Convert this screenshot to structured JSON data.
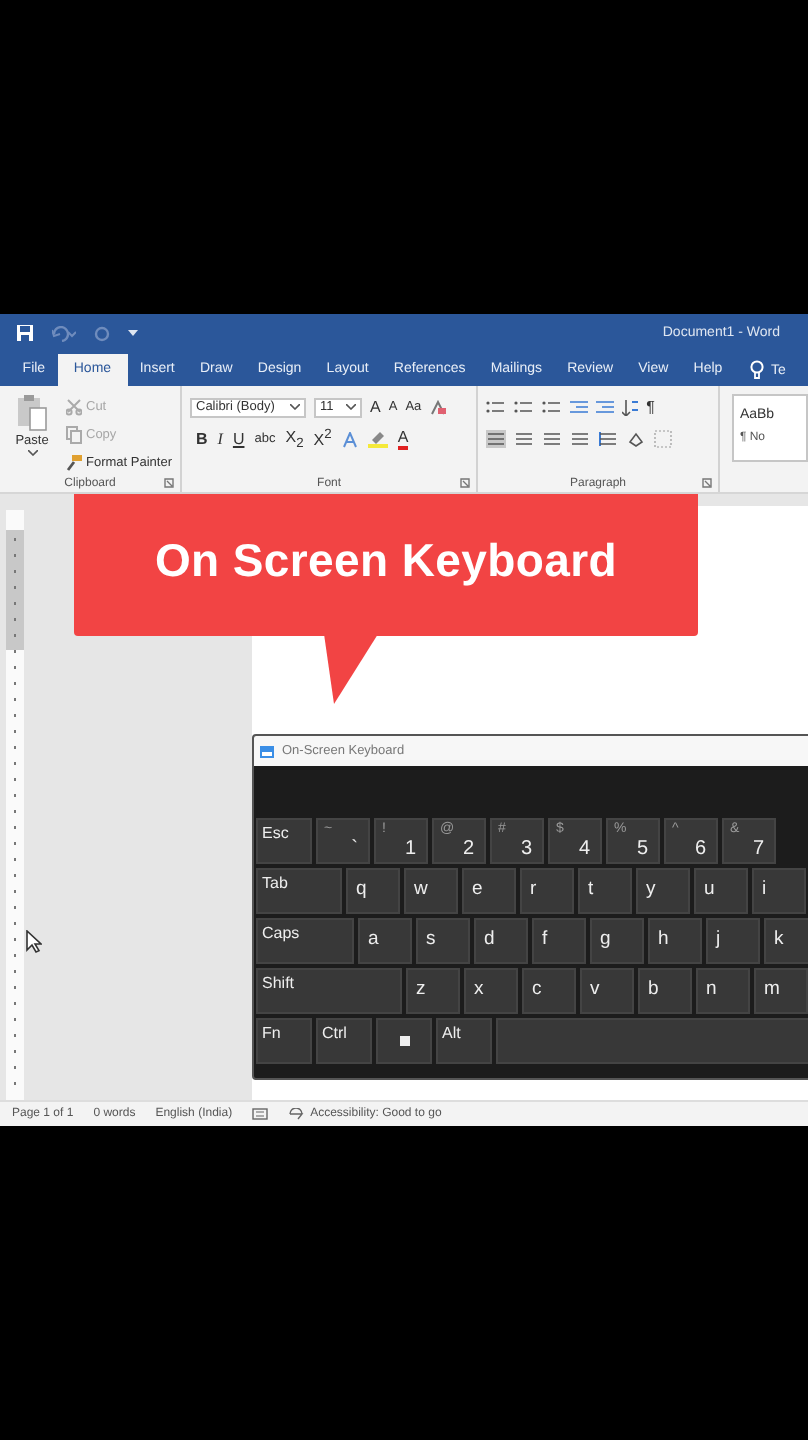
{
  "window": {
    "title": "Document1 - Word"
  },
  "tabs": [
    {
      "label": "File",
      "selected": false
    },
    {
      "label": "Home",
      "selected": true
    },
    {
      "label": "Insert",
      "selected": false
    },
    {
      "label": "Draw",
      "selected": false
    },
    {
      "label": "Design",
      "selected": false
    },
    {
      "label": "Layout",
      "selected": false
    },
    {
      "label": "References",
      "selected": false
    },
    {
      "label": "Mailings",
      "selected": false
    },
    {
      "label": "Review",
      "selected": false
    },
    {
      "label": "View",
      "selected": false
    },
    {
      "label": "Help",
      "selected": false
    }
  ],
  "tell_me": {
    "label": "Te"
  },
  "clipboard": {
    "label": "Clipboard",
    "paste": "Paste",
    "items": [
      {
        "label": "Cut",
        "disabled": true
      },
      {
        "label": "Copy",
        "disabled": true
      },
      {
        "label": "Format Painter",
        "disabled": false
      }
    ]
  },
  "font": {
    "label": "Font",
    "family": "Calibri (Body)",
    "size": "11",
    "grow": "A",
    "shrink": "A",
    "change_case": "Aa",
    "bold": "B",
    "italic": "I",
    "underline": "U",
    "strikethrough": "abc",
    "subscript": "X$_{2}$",
    "superscript": "X$^{2}$",
    "font_color": "A"
  },
  "paragraph": {
    "label": "Paragraph",
    "show_marks": "¶"
  },
  "styles": {
    "preview": "AaBb",
    "name": "¶ No"
  },
  "callout": {
    "text": "On Screen Keyboard"
  },
  "keyboard": {
    "title": "On-Screen Keyboard",
    "rows": [
      [
        {
          "kind": "text",
          "label": "Esc"
        },
        {
          "kind": "symbol",
          "shift": "~",
          "label": "`"
        },
        {
          "kind": "symbol",
          "shift": "!",
          "label": "1"
        },
        {
          "kind": "symbol",
          "shift": "@",
          "label": "2"
        },
        {
          "kind": "symbol",
          "shift": "#",
          "label": "3"
        },
        {
          "kind": "symbol",
          "shift": "$",
          "label": "4"
        },
        {
          "kind": "symbol",
          "shift": "%",
          "label": "5"
        },
        {
          "kind": "symbol",
          "shift": "^",
          "label": "6"
        },
        {
          "kind": "symbol",
          "shift": "&",
          "label": "7"
        }
      ],
      [
        {
          "kind": "text",
          "label": "Tab"
        },
        {
          "kind": "letter",
          "label": "q"
        },
        {
          "kind": "letter",
          "label": "w"
        },
        {
          "kind": "letter",
          "label": "e"
        },
        {
          "kind": "letter",
          "label": "r"
        },
        {
          "kind": "letter",
          "label": "t"
        },
        {
          "kind": "letter",
          "label": "y"
        },
        {
          "kind": "letter",
          "label": "u"
        },
        {
          "kind": "letter",
          "label": "i"
        }
      ],
      [
        {
          "kind": "text",
          "label": "Caps"
        },
        {
          "kind": "letter",
          "label": "a"
        },
        {
          "kind": "letter",
          "label": "s"
        },
        {
          "kind": "letter",
          "label": "d"
        },
        {
          "kind": "letter",
          "label": "f"
        },
        {
          "kind": "letter",
          "label": "g"
        },
        {
          "kind": "letter",
          "label": "h"
        },
        {
          "kind": "letter",
          "label": "j"
        },
        {
          "kind": "letter",
          "label": "k"
        }
      ],
      [
        {
          "kind": "text",
          "label": "Shift"
        },
        {
          "kind": "letter",
          "label": "z"
        },
        {
          "kind": "letter",
          "label": "x"
        },
        {
          "kind": "letter",
          "label": "c"
        },
        {
          "kind": "letter",
          "label": "v"
        },
        {
          "kind": "letter",
          "label": "b"
        },
        {
          "kind": "letter",
          "label": "n"
        },
        {
          "kind": "letter",
          "label": "m"
        }
      ],
      [
        {
          "kind": "text",
          "label": "Fn"
        },
        {
          "kind": "text",
          "label": "Ctrl"
        },
        {
          "kind": "windows"
        },
        {
          "kind": "text",
          "label": "Alt"
        },
        {
          "kind": "space"
        }
      ]
    ]
  },
  "status_bar": {
    "items": [
      "Page 1 of 1",
      "0 words",
      "English (India)"
    ],
    "accessibility": "Accessibility: Good to go"
  }
}
